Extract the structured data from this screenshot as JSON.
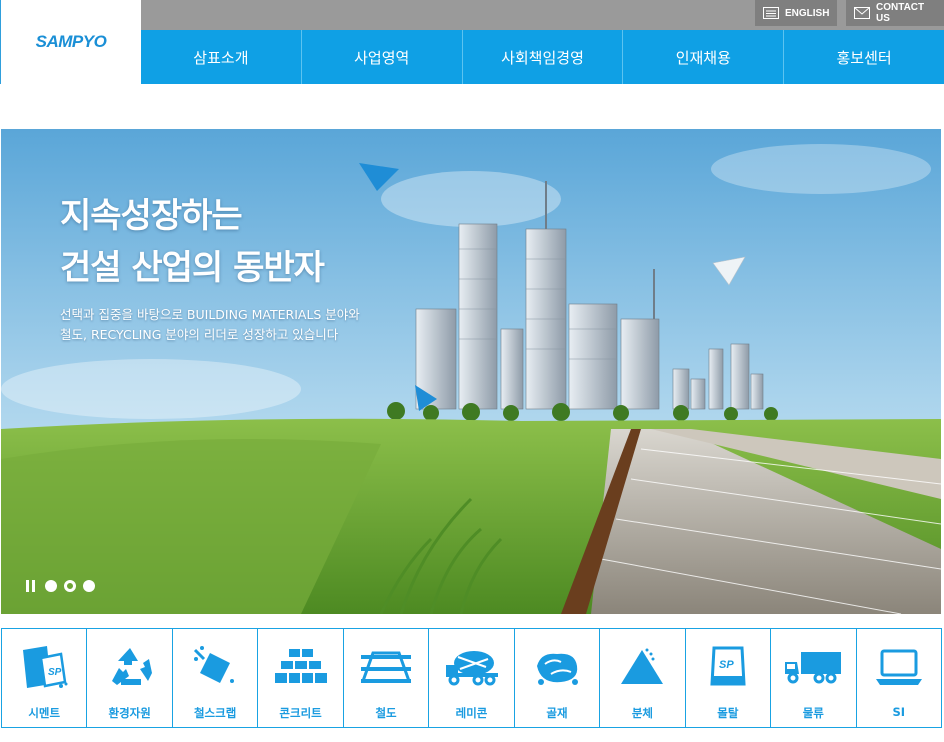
{
  "header": {
    "logo_text": "SAMPYO",
    "utility": {
      "english_label": "ENGLISH",
      "contact_label": "CONTACT US"
    },
    "nav": [
      {
        "label": "삼표소개"
      },
      {
        "label": "사업영역"
      },
      {
        "label": "사회책임경영"
      },
      {
        "label": "인재채용"
      },
      {
        "label": "홍보센터"
      }
    ]
  },
  "hero": {
    "title_line1": "지속성장하는",
    "title_line2": "건설 산업의 동반자",
    "subtitle_line1": "선택과 집중을 바탕으로 BUILDING MATERIALS 분야와",
    "subtitle_line2": "철도, RECYCLING 분야의 리더로 성장하고 있습니다",
    "slides": {
      "count": 3,
      "active": 2
    }
  },
  "categories": [
    {
      "label": "시멘트",
      "icon": "cement-bag-icon"
    },
    {
      "label": "환경자원",
      "icon": "recycle-icon"
    },
    {
      "label": "철스크랩",
      "icon": "scrap-metal-icon"
    },
    {
      "label": "콘크리트",
      "icon": "concrete-blocks-icon"
    },
    {
      "label": "철도",
      "icon": "railway-icon"
    },
    {
      "label": "레미콘",
      "icon": "mixer-truck-icon"
    },
    {
      "label": "골재",
      "icon": "aggregate-icon"
    },
    {
      "label": "분체",
      "icon": "powder-pile-icon"
    },
    {
      "label": "몰탈",
      "icon": "mortar-bag-icon"
    },
    {
      "label": "물류",
      "icon": "logistics-truck-icon"
    },
    {
      "label": "SI",
      "icon": "laptop-icon"
    }
  ],
  "colors": {
    "brand_blue": "#0fa0e5",
    "topbar_gray": "#9a9a9a",
    "utility_gray": "#7f7f7f",
    "category_blue": "#1a9be0"
  }
}
